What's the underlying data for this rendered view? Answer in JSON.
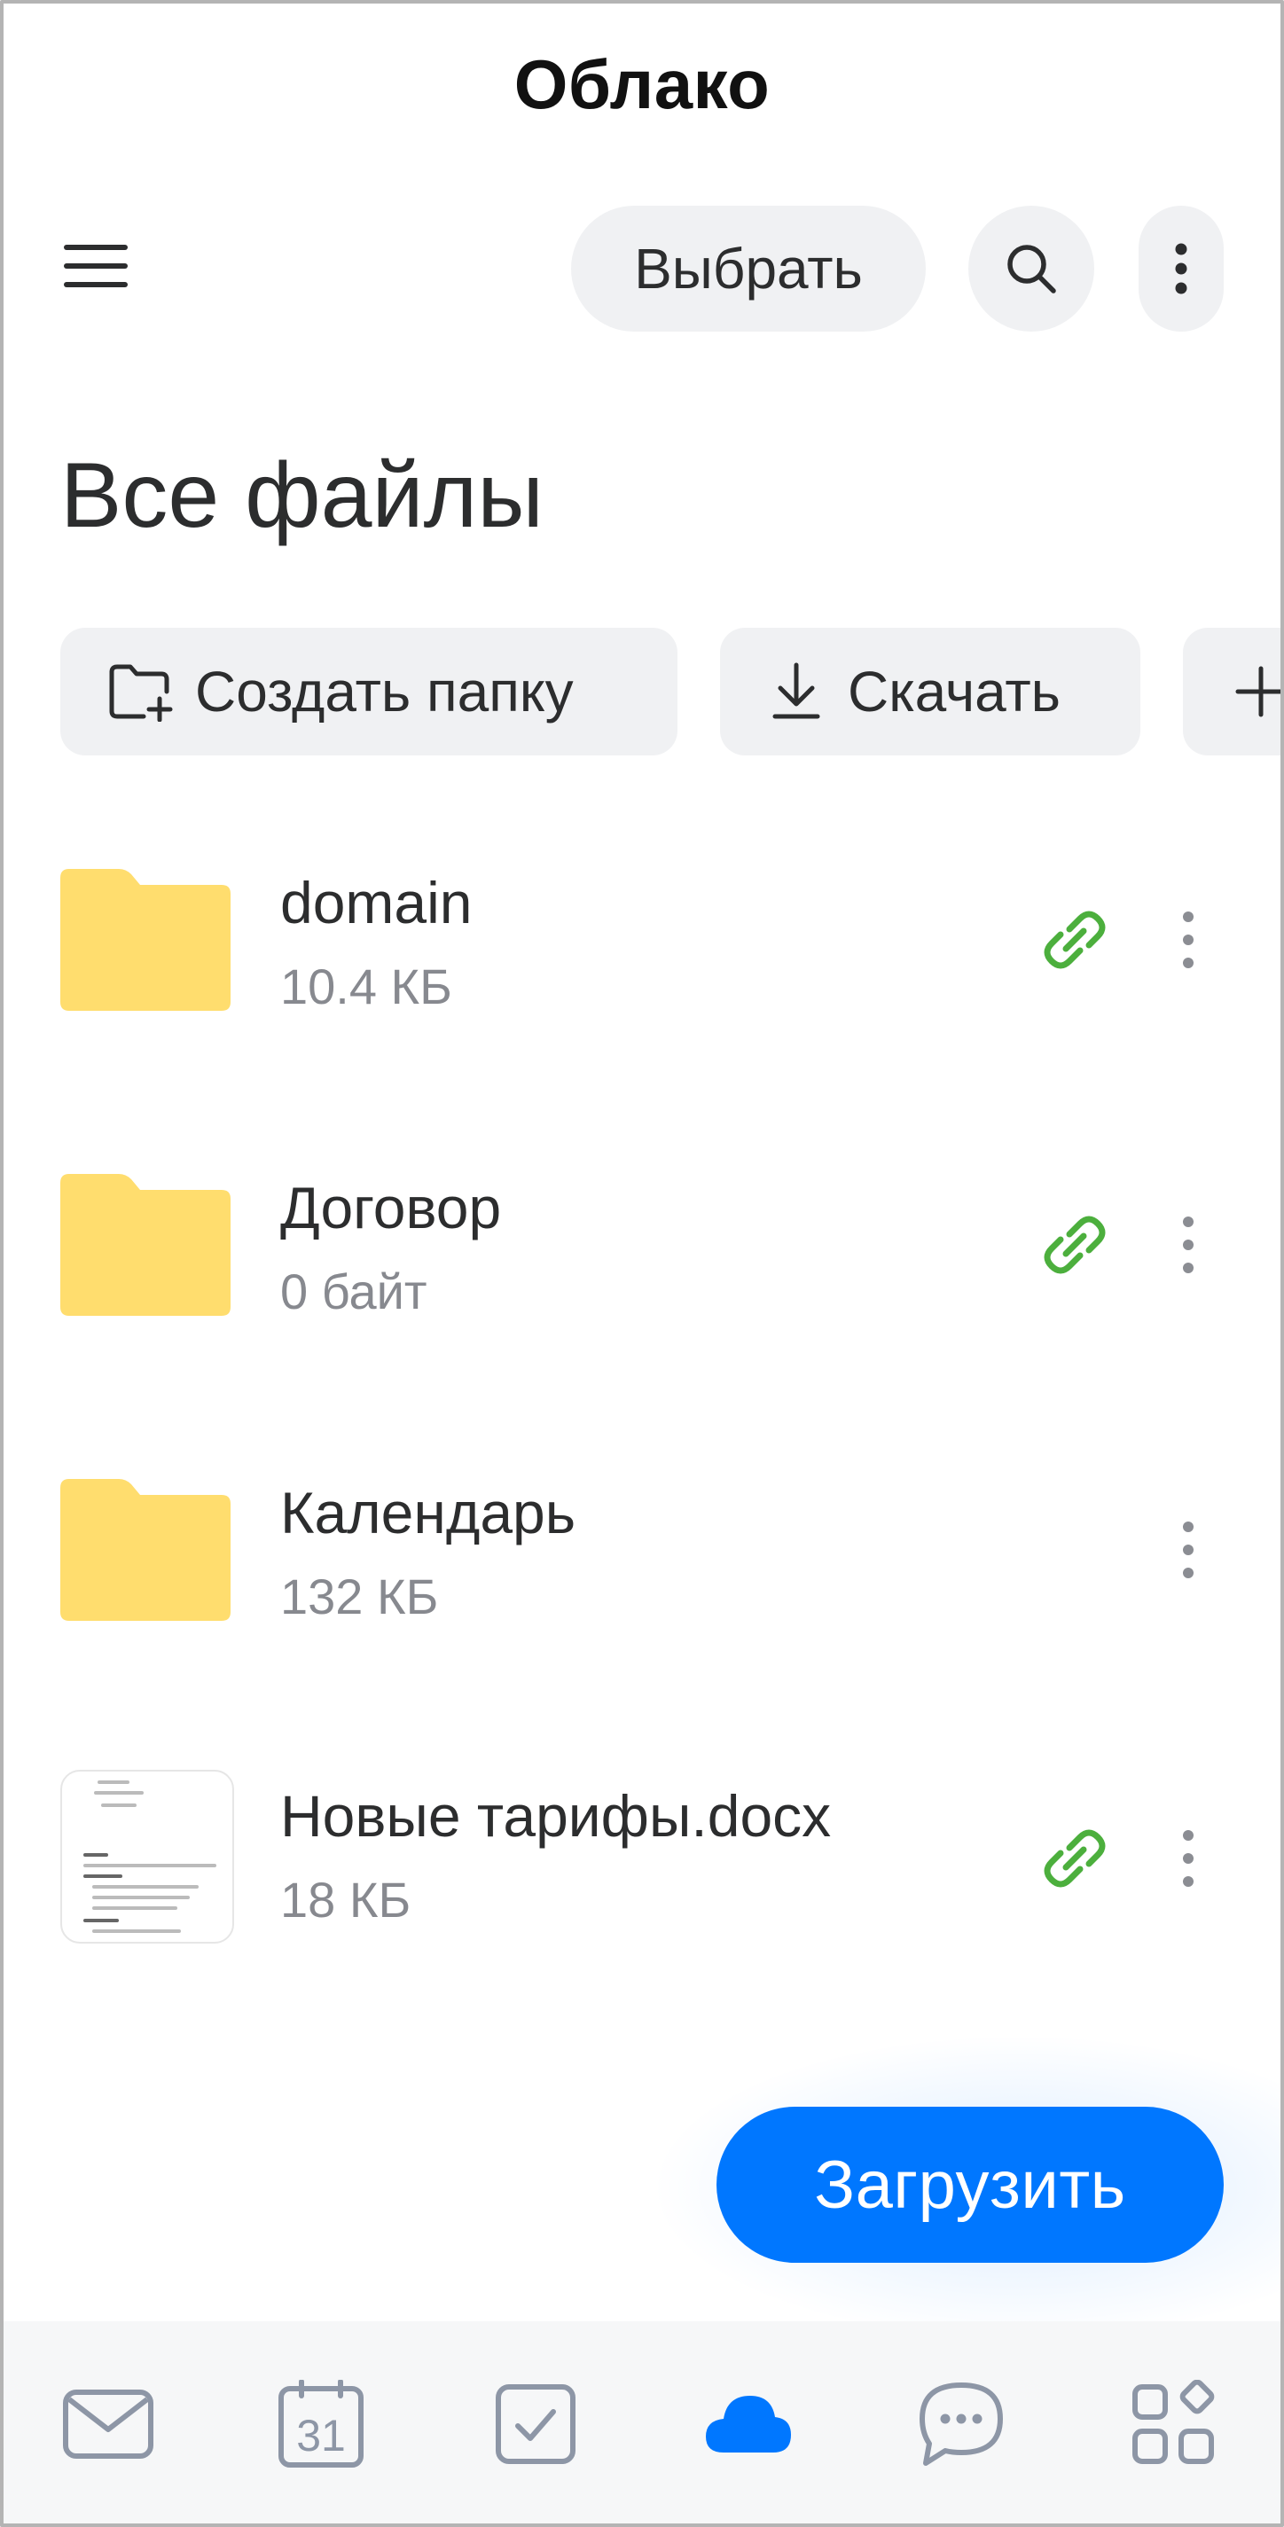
{
  "header": {
    "title": "Облако",
    "select_label": "Выбрать",
    "menu_icon": "hamburger-menu-icon",
    "search_icon": "search-icon",
    "more_icon": "more-vertical-icon"
  },
  "main": {
    "heading": "Все файлы",
    "actions": [
      {
        "label": "Создать папку",
        "icon": "folder-plus-icon"
      },
      {
        "label": "Скачать",
        "icon": "download-icon"
      },
      {
        "label": "",
        "icon": "plus-icon"
      }
    ],
    "files": [
      {
        "name": "domain",
        "size": "10.4 КБ",
        "type": "folder",
        "shared": true
      },
      {
        "name": "Договор",
        "size": "0 байт",
        "type": "folder",
        "shared": true
      },
      {
        "name": "Календарь",
        "size": "132 КБ",
        "type": "folder",
        "shared": false
      },
      {
        "name": "Новые тарифы.docx",
        "size": "18 КБ",
        "type": "document",
        "shared": true
      }
    ],
    "upload_label": "Загрузить"
  },
  "tabbar": {
    "items": [
      {
        "icon": "mail-icon",
        "active": false
      },
      {
        "icon": "calendar-icon",
        "text": "31",
        "active": false
      },
      {
        "icon": "tasks-icon",
        "active": false
      },
      {
        "icon": "cloud-icon",
        "active": true
      },
      {
        "icon": "chat-icon",
        "active": false
      },
      {
        "icon": "apps-icon",
        "active": false
      }
    ]
  },
  "colors": {
    "accent": "#0077ff",
    "folder": "#ffdd6e",
    "link": "#4caf3d",
    "chip_bg": "#f0f1f3",
    "secondary_text": "#87898f",
    "icon_inactive": "#8d96a6"
  }
}
